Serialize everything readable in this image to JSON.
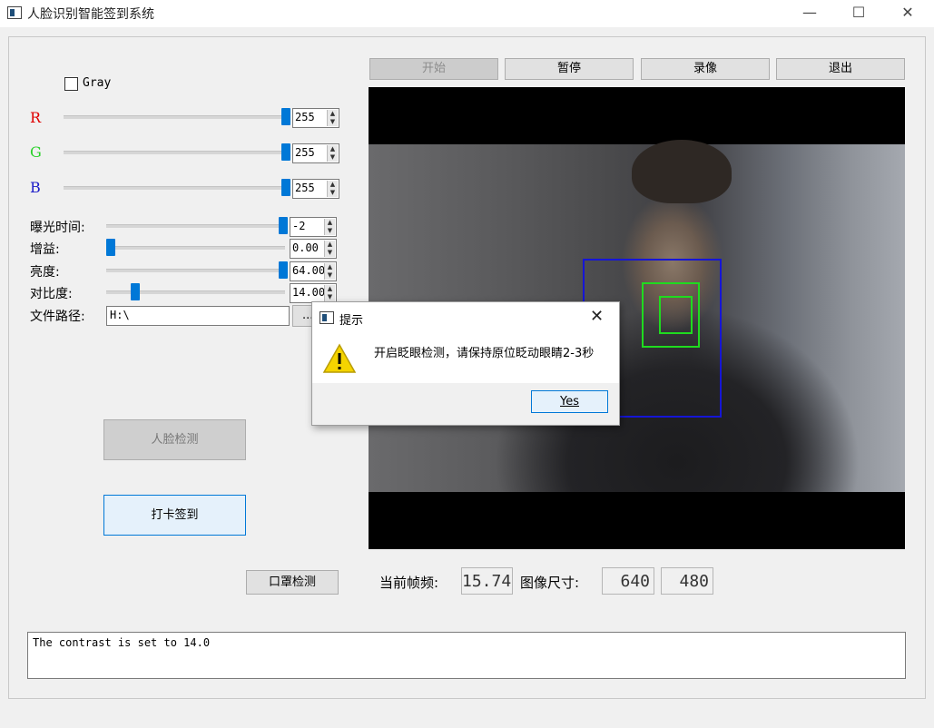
{
  "window": {
    "title": "人脸识别智能签到系统",
    "minimize_icon": "—",
    "maximize_icon": "☐",
    "close_icon": "✕"
  },
  "controls": {
    "gray_label": "Gray",
    "gray_checked": false,
    "rgb": [
      {
        "label": "R",
        "value": "255",
        "color": "#e00000"
      },
      {
        "label": "G",
        "value": "255",
        "color": "#2ad12a"
      },
      {
        "label": "B",
        "value": "255",
        "color": "#1c1cc8"
      }
    ],
    "params": [
      {
        "label": "曝光时间:",
        "value": "-2"
      },
      {
        "label": "增益:",
        "value": "0.00"
      },
      {
        "label": "亮度:",
        "value": "64.00"
      },
      {
        "label": "对比度:",
        "value": "14.00"
      }
    ],
    "path_label": "文件路径:",
    "path_value": "H:\\",
    "browse_label": "..."
  },
  "buttons": {
    "start": "开始",
    "pause": "暂停",
    "record": "录像",
    "exit": "退出",
    "face_detect": "人脸检测",
    "check_in": "打卡签到",
    "mask_detect": "口罩检测"
  },
  "readouts": {
    "fps_label": "当前帧频:",
    "fps_value": "15.74",
    "size_label": "图像尺寸:",
    "width": "640",
    "height": "480"
  },
  "log": {
    "text": "The contrast is set to 14.0"
  },
  "dialog": {
    "title": "提示",
    "message": "开启眨眼检测，请保持原位眨动眼睛2-3秒",
    "yes_label": "Yes",
    "icon": "warning-icon",
    "close_icon": "✕"
  }
}
